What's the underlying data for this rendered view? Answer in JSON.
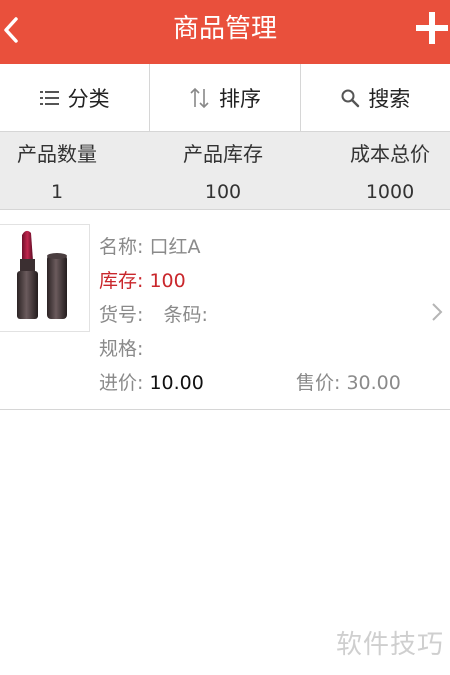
{
  "header": {
    "title": "商品管理"
  },
  "toolbar": {
    "category_label": "分类",
    "sort_label": "排序",
    "search_label": "搜索"
  },
  "summary": {
    "count": {
      "label": "产品数量",
      "value": "1"
    },
    "stock": {
      "label": "产品库存",
      "value": "100"
    },
    "cost": {
      "label": "成本总价",
      "value": "1000"
    }
  },
  "product": {
    "name_label": "名称:",
    "name": "口红A",
    "stock_label": "库存:",
    "stock": "100",
    "sku_label": "货号:",
    "barcode_label": "条码:",
    "spec_label": "规格:",
    "purchase_label": "进价:",
    "purchase_price": "10.00",
    "sell_label": "售价:",
    "sell_price": "30.00"
  },
  "watermark": "软件技巧",
  "colors": {
    "accent": "#e9503c",
    "stock": "#c9272c"
  }
}
